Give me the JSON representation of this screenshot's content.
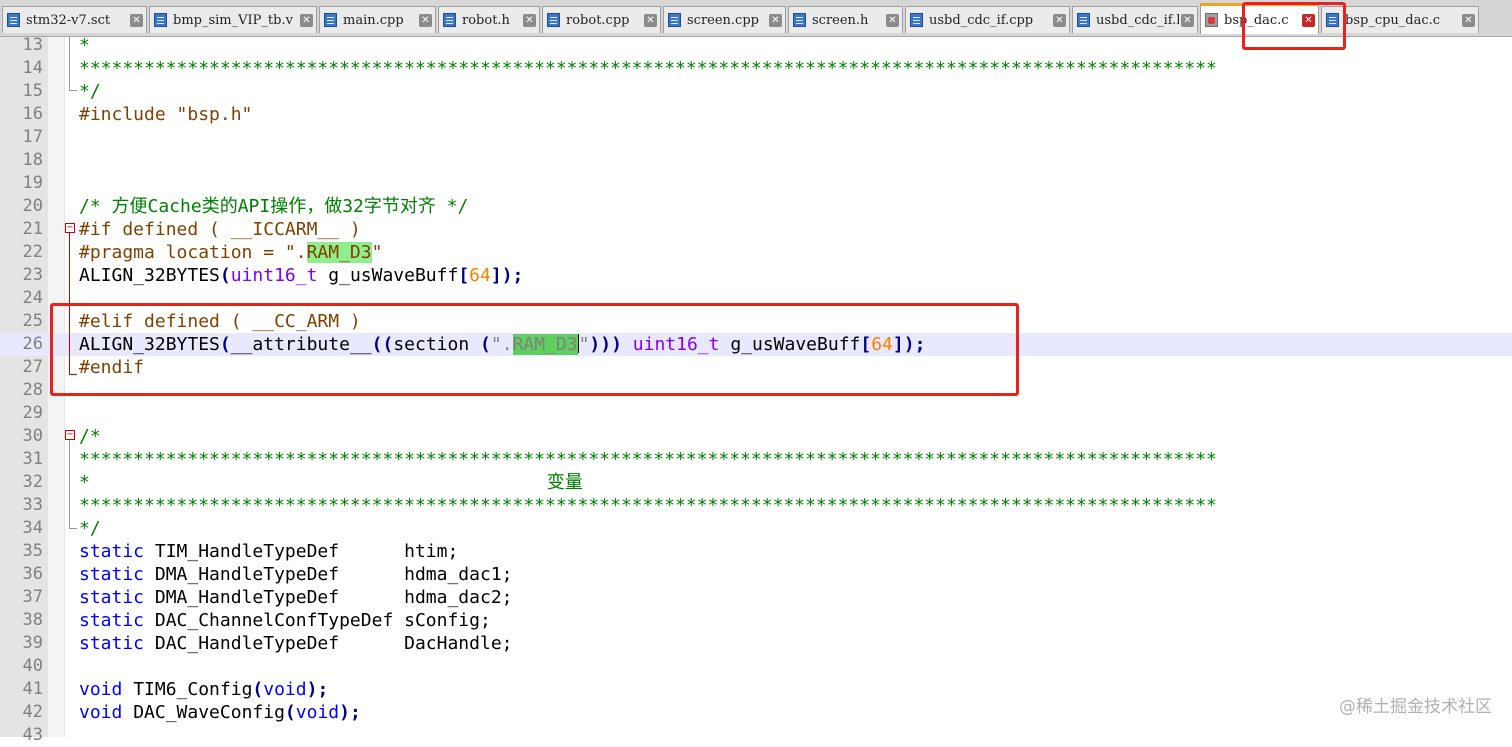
{
  "tabs": [
    {
      "label": "stm32-v7.sct",
      "active": false
    },
    {
      "label": "bmp_sim_VIP_tb.v",
      "active": false
    },
    {
      "label": "main.cpp",
      "active": false
    },
    {
      "label": "robot.h",
      "active": false
    },
    {
      "label": "robot.cpp",
      "active": false
    },
    {
      "label": "screen.cpp",
      "active": false
    },
    {
      "label": "screen.h",
      "active": false
    },
    {
      "label": "usbd_cdc_if.cpp",
      "active": false
    },
    {
      "label": "usbd_cdc_if.h",
      "active": false
    },
    {
      "label": "bsp_dac.c",
      "active": true
    },
    {
      "label": "bsp_cpu_dac.c",
      "active": false
    }
  ],
  "close_glyph": "✕",
  "fold": {
    "minus": "−"
  },
  "lines": [
    {
      "n": "13"
    },
    {
      "n": "14"
    },
    {
      "n": "15"
    },
    {
      "n": "16"
    },
    {
      "n": "17"
    },
    {
      "n": "18"
    },
    {
      "n": "19"
    },
    {
      "n": "20"
    },
    {
      "n": "21"
    },
    {
      "n": "22"
    },
    {
      "n": "23"
    },
    {
      "n": "24"
    },
    {
      "n": "25"
    },
    {
      "n": "26"
    },
    {
      "n": "27"
    },
    {
      "n": "28"
    },
    {
      "n": "29"
    },
    {
      "n": "30"
    },
    {
      "n": "31"
    },
    {
      "n": "32"
    },
    {
      "n": "33"
    },
    {
      "n": "34"
    },
    {
      "n": "35"
    },
    {
      "n": "36"
    },
    {
      "n": "37"
    },
    {
      "n": "38"
    },
    {
      "n": "39"
    },
    {
      "n": "40"
    },
    {
      "n": "41"
    },
    {
      "n": "42"
    },
    {
      "n": "43"
    }
  ],
  "code": {
    "l13": "*",
    "stars": "*********************************************************************************************************",
    "l15": "*/",
    "l16": "#include \"bsp.h\"",
    "l20": "/* 方便Cache类的API操作，做32字节对齐 */",
    "l21": "#if defined ( __ICCARM__ )",
    "l22_a": "#pragma location = \".",
    "l22_b": "RAM_D3",
    "l22_c": "\"",
    "l23_a": "ALIGN_32BYTES",
    "l23_b": "(",
    "l23_c": "uint16_t",
    "l23_d": " g_usWaveBuff",
    "l23_e": "[",
    "l23_f": "64",
    "l23_g": "]);",
    "l25": "#elif defined ( __CC_ARM )",
    "l26_a": "ALIGN_32BYTES",
    "l26_b": "(",
    "l26_c": "__attribute__",
    "l26_d": "((",
    "l26_e": "section ",
    "l26_f": "(",
    "l26_g": "\".",
    "l26_h": "RAM_D3",
    "l26_i": "\"",
    "l26_j": "))) ",
    "l26_k": "uint16_t",
    "l26_l": " g_usWaveBuff",
    "l26_m": "[",
    "l26_n": "64",
    "l26_o": "]);",
    "l27": "#endif",
    "l30": "/*",
    "l32_a": "*",
    "l32_b": "变量",
    "l34": "*/",
    "static": "static",
    "void": "void",
    "l35_t": " TIM_HandleTypeDef      htim;",
    "l36_t": " DMA_HandleTypeDef      hdma_dac1;",
    "l37_t": " DMA_HandleTypeDef      hdma_dac2;",
    "l38_t": " DAC_ChannelConfTypeDef sConfig;",
    "l39_t": " DAC_HandleTypeDef      DacHandle;",
    "l41_a": " TIM6_Config",
    "l42_a": " DAC_WaveConfig",
    "paren_open": "(",
    "paren_close_semi": ");"
  },
  "watermark": "@稀土掘金技术社区"
}
